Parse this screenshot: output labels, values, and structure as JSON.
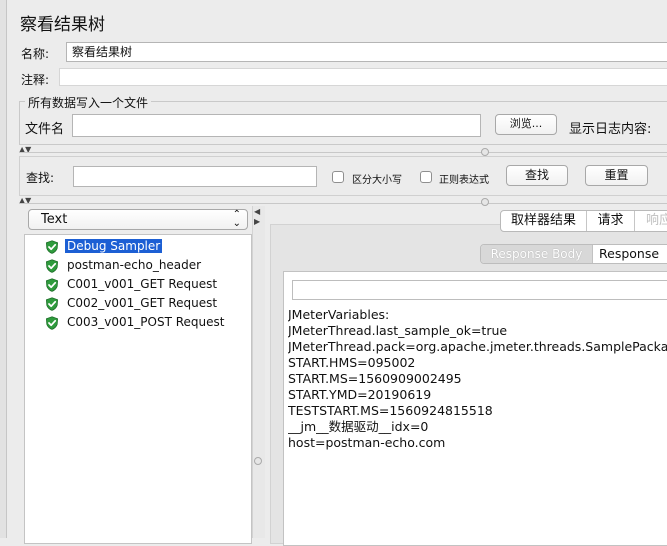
{
  "window_title": "察看结果树",
  "name_row": {
    "label": "名称:",
    "value": "察看结果树"
  },
  "comment_row": {
    "label": "注释:",
    "value": ""
  },
  "file_group": {
    "legend": "所有数据写入一个文件",
    "filename_label": "文件名",
    "filename_value": "",
    "browse_label": "浏览...",
    "log_label": "显示日志内容:"
  },
  "search": {
    "label": "查找:",
    "value": "",
    "case_label": "区分大小写",
    "regex_label": "正则表达式",
    "find_button": "查找",
    "reset_button": "重置"
  },
  "splitter_arrows": {
    "up_down": "▲▼",
    "left": "◀",
    "right": "▶"
  },
  "renderer_select": {
    "value": "Text",
    "arrow": "⌃⌄"
  },
  "tree_items": [
    {
      "label": "Debug Sampler",
      "selected": true
    },
    {
      "label": "postman-echo_header",
      "selected": false
    },
    {
      "label": "C001_v001_GET Request",
      "selected": false
    },
    {
      "label": "C002_v001_GET Request",
      "selected": false
    },
    {
      "label": "C003_v001_POST Request",
      "selected": false
    }
  ],
  "result_tabs": [
    {
      "label": "取样器结果",
      "active": false
    },
    {
      "label": "请求",
      "active": false
    },
    {
      "label": "响应",
      "active": true
    }
  ],
  "response_subtabs": [
    {
      "label": "Response Body",
      "disabled": true
    },
    {
      "label": "Response",
      "active": true
    }
  ],
  "response_search_value": "",
  "response_lines": [
    "JMeterVariables:",
    "JMeterThread.last_sample_ok=true",
    "JMeterThread.pack=org.apache.jmeter.threads.SamplePackage",
    "START.HMS=095002",
    "START.MS=1560909002495",
    "START.YMD=20190619",
    "TESTSTART.MS=1560924815518",
    "__jm__数据驱动__idx=0",
    "host=postman-echo.com"
  ],
  "colors": {
    "selection": "#1c5fd4",
    "shield": "#2e9b3c",
    "background": "#ececec"
  }
}
